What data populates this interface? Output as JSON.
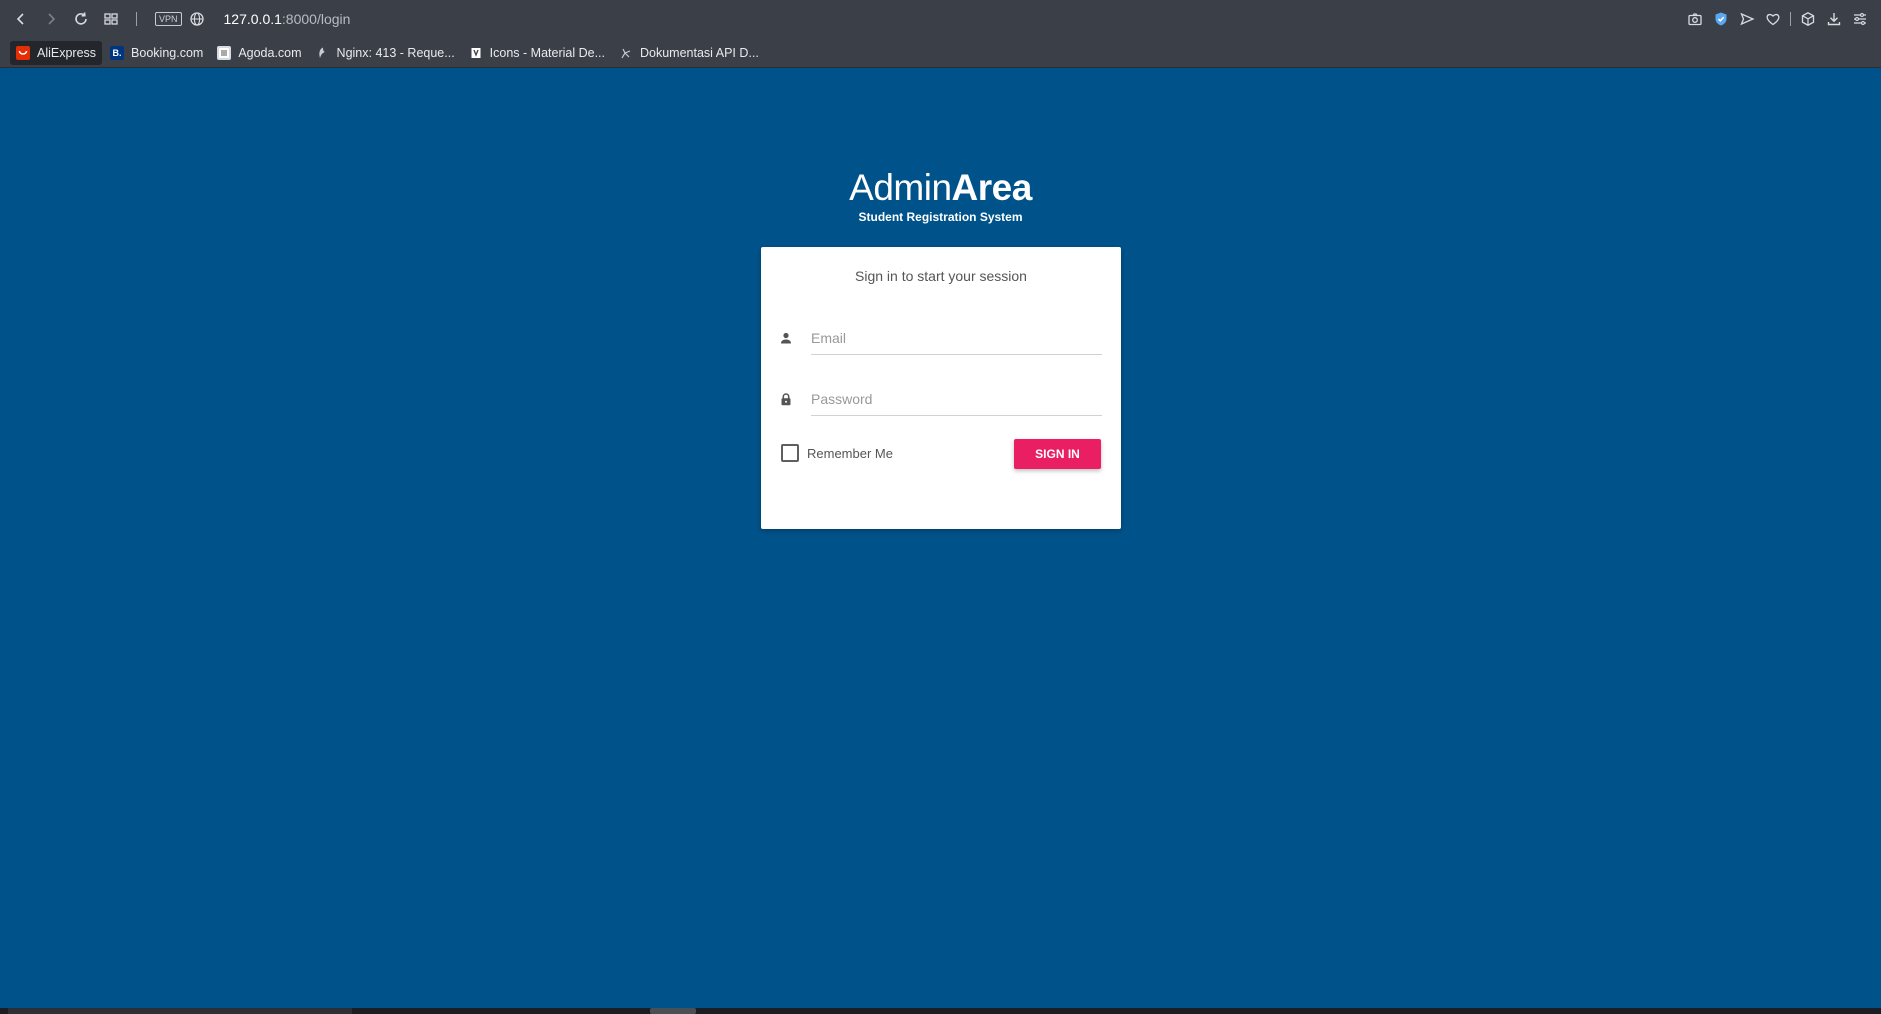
{
  "browser": {
    "vpn_label": "VPN",
    "url_host": "127.0.0.1",
    "url_path": ":8000/login",
    "bookmarks": [
      {
        "label": "AliExpress",
        "icon": "aliexpress-icon",
        "color": "#e62e04"
      },
      {
        "label": "Booking.com",
        "icon": "booking-icon",
        "color": "#003580",
        "glyph": "B."
      },
      {
        "label": "Agoda.com",
        "icon": "agoda-icon",
        "color": "#9aa0a8"
      },
      {
        "label": "Nginx: 413 - Reque...",
        "icon": "nginx-icon",
        "color": "#9aa0a8"
      },
      {
        "label": "Icons - Material De...",
        "icon": "material-icon",
        "color": "#9aa0a8"
      },
      {
        "label": "Dokumentasi API D...",
        "icon": "api-docs-icon",
        "color": "#9aa0a8"
      }
    ]
  },
  "login": {
    "brand_light": "Admin",
    "brand_bold": "Area",
    "subtitle": "Student Registration System",
    "message": "Sign in to start your session",
    "email_placeholder": "Email",
    "password_placeholder": "Password",
    "remember_label": "Remember Me",
    "signin_label": "SIGN IN"
  },
  "colors": {
    "page_bg": "#00538a",
    "accent": "#e91e63",
    "chrome_bg": "#3b4048"
  }
}
